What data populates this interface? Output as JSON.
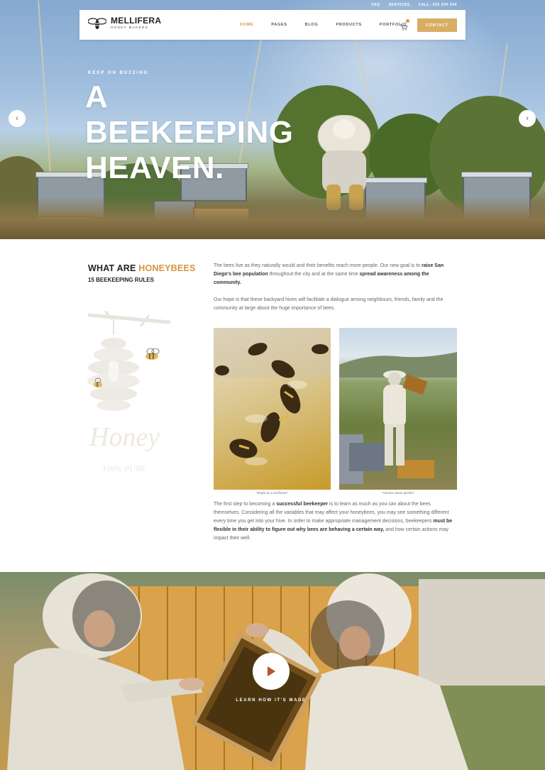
{
  "utility_nav": [
    "FAQ",
    "SERVICES",
    "CALL: 555 000 044"
  ],
  "brand": {
    "name": "MELLIFERA",
    "tagline": "HONEY MAKERS"
  },
  "menu": [
    {
      "label": "HOME",
      "active": true
    },
    {
      "label": "PAGES",
      "active": false
    },
    {
      "label": "BLOG",
      "active": false
    },
    {
      "label": "PRODUCTS",
      "active": false
    },
    {
      "label": "PORTFOLIO",
      "active": false
    }
  ],
  "contact_label": "CONTACT",
  "cart_icon": "cart-icon",
  "accent_color": "#d8953c",
  "button_color": "#d8ae63",
  "hero": {
    "kicker": "KEEP ON BUZZING",
    "title_line1": "A BEEKEEPING",
    "title_line2": "HEAVEN.",
    "prev_icon": "chevron-left-icon",
    "next_icon": "chevron-right-icon"
  },
  "about": {
    "heading_start": "WHAT ARE ",
    "heading_highlight": "HONEYBEES",
    "subheading": "15 BEEKEEPING RULES",
    "illustration_text": "Honey",
    "illustration_subtext": "100% PURE",
    "p1_a": "The bees live as they naturally would and their benefits reach more people. Our new goal is to ",
    "p1_b": "raise San Diego's bee population",
    "p1_c": " throughout the city and at the same time ",
    "p1_d": "spread awareness among the community.",
    "p2": "Our hope is that these backyard hives will facilitate a dialogue among neighbours, friends, family and the community at large about the huge importance of bees.",
    "caption1": "\"Bright as a sunflower\"",
    "caption2": "\"Garden sweet garden\"",
    "p3_a": "The first step to becoming a ",
    "p3_b": "successful beekeeper",
    "p3_c": " is to learn as much as you can about the bees themselves. Considering all the variables that may affect your honeybees, you may see something different every time you get into your hive. In order to make appropriate management decisions, beekeepers ",
    "p3_d": "must be flexible in their ability to figure out why bees are behaving a certain way,",
    "p3_e": " and how certain actions may impact their well."
  },
  "video": {
    "label": "LEARN HOW IT'S MADE",
    "play_icon": "play-icon"
  }
}
